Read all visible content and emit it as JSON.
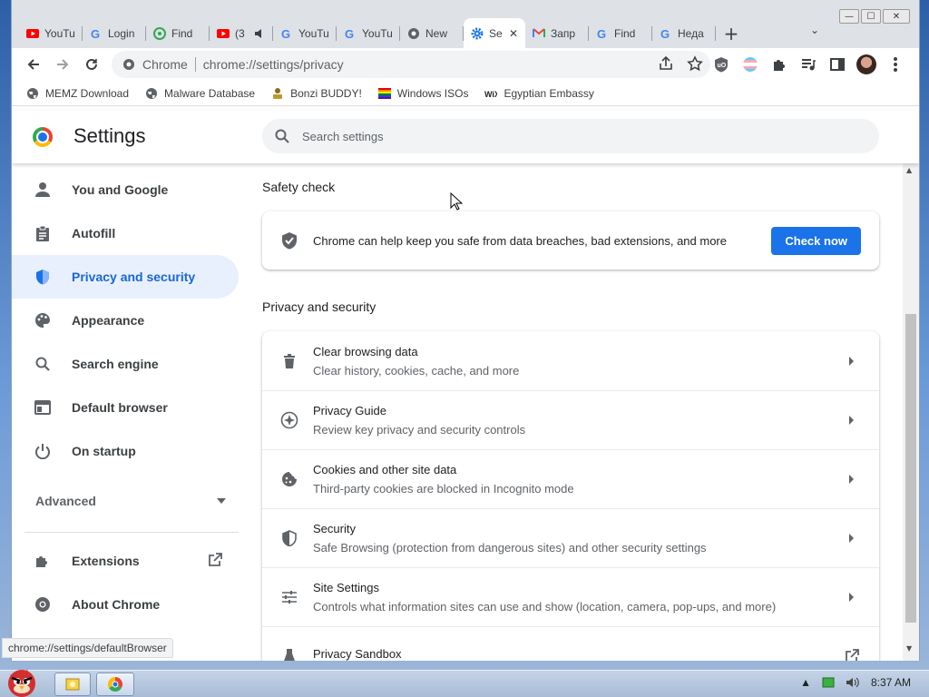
{
  "window": {
    "controls": {
      "minimize": "—",
      "maximize": "☐",
      "close": "✕"
    }
  },
  "tabs": [
    {
      "title": "YouTu",
      "icon": "youtube-icon",
      "color": "#ff0000"
    },
    {
      "title": "Login",
      "icon": "google-icon",
      "color": "#4285f4"
    },
    {
      "title": "Find",
      "icon": "green-circle-icon",
      "color": "#34a853"
    },
    {
      "title": "(3",
      "icon": "youtube-icon",
      "color": "#ff0000",
      "audio": true
    },
    {
      "title": "YouTu",
      "icon": "google-icon",
      "color": "#4285f4"
    },
    {
      "title": "YouTu",
      "icon": "google-icon",
      "color": "#4285f4"
    },
    {
      "title": "New",
      "icon": "chrome-icon",
      "color": "#5f6368"
    },
    {
      "title": "Se",
      "icon": "gear-icon",
      "color": "#1a73e8",
      "active": true
    },
    {
      "title": "Запр",
      "icon": "gmail-icon",
      "color": "#ea4335"
    },
    {
      "title": "Find",
      "icon": "google-icon",
      "color": "#4285f4"
    },
    {
      "title": "Неда",
      "icon": "google-icon",
      "color": "#4285f4"
    }
  ],
  "toolbar": {
    "host_label": "Chrome",
    "url": "chrome://settings/privacy"
  },
  "bookmarks": [
    {
      "label": "MEMZ Download",
      "icon": "globe-icon"
    },
    {
      "label": "Malware Database",
      "icon": "globe-icon"
    },
    {
      "label": "Bonzi BUDDY!",
      "icon": "bonzi-icon"
    },
    {
      "label": "Windows ISOs",
      "icon": "rainbow-flag-icon"
    },
    {
      "label": "Egyptian Embassy",
      "icon": "wix-icon"
    }
  ],
  "settings": {
    "title": "Settings",
    "search_placeholder": "Search settings"
  },
  "sidebar": {
    "items": [
      {
        "label": "You and Google",
        "icon": "person-icon"
      },
      {
        "label": "Autofill",
        "icon": "clipboard-icon"
      },
      {
        "label": "Privacy and security",
        "icon": "shield-icon",
        "active": true
      },
      {
        "label": "Appearance",
        "icon": "palette-icon"
      },
      {
        "label": "Search engine",
        "icon": "search-icon"
      },
      {
        "label": "Default browser",
        "icon": "browser-window-icon"
      },
      {
        "label": "On startup",
        "icon": "power-icon"
      }
    ],
    "advanced_label": "Advanced",
    "extensions_label": "Extensions",
    "about_label": "About Chrome"
  },
  "safety_check": {
    "heading": "Safety check",
    "text": "Chrome can help keep you safe from data breaches, bad extensions, and more",
    "button_label": "Check now"
  },
  "privacy": {
    "heading": "Privacy and security",
    "rows": [
      {
        "title": "Clear browsing data",
        "subtitle": "Clear history, cookies, cache, and more",
        "icon": "trash-icon"
      },
      {
        "title": "Privacy Guide",
        "subtitle": "Review key privacy and security controls",
        "icon": "compass-icon"
      },
      {
        "title": "Cookies and other site data",
        "subtitle": "Third-party cookies are blocked in Incognito mode",
        "icon": "cookie-icon"
      },
      {
        "title": "Security",
        "subtitle": "Safe Browsing (protection from dangerous sites) and other security settings",
        "icon": "shield-icon"
      },
      {
        "title": "Site Settings",
        "subtitle": "Controls what information sites can use and show (location, camera, pop-ups, and more)",
        "icon": "tune-icon"
      },
      {
        "title": "Privacy Sandbox",
        "subtitle": "",
        "icon": "flask-icon"
      }
    ]
  },
  "status_bar": {
    "url": "chrome://settings/defaultBrowser"
  },
  "taskbar": {
    "time": "8:37 AM"
  },
  "colors": {
    "accent": "#1a73e8",
    "active_nav_bg": "#e8f0fe",
    "active_nav_text": "#1967d2"
  }
}
